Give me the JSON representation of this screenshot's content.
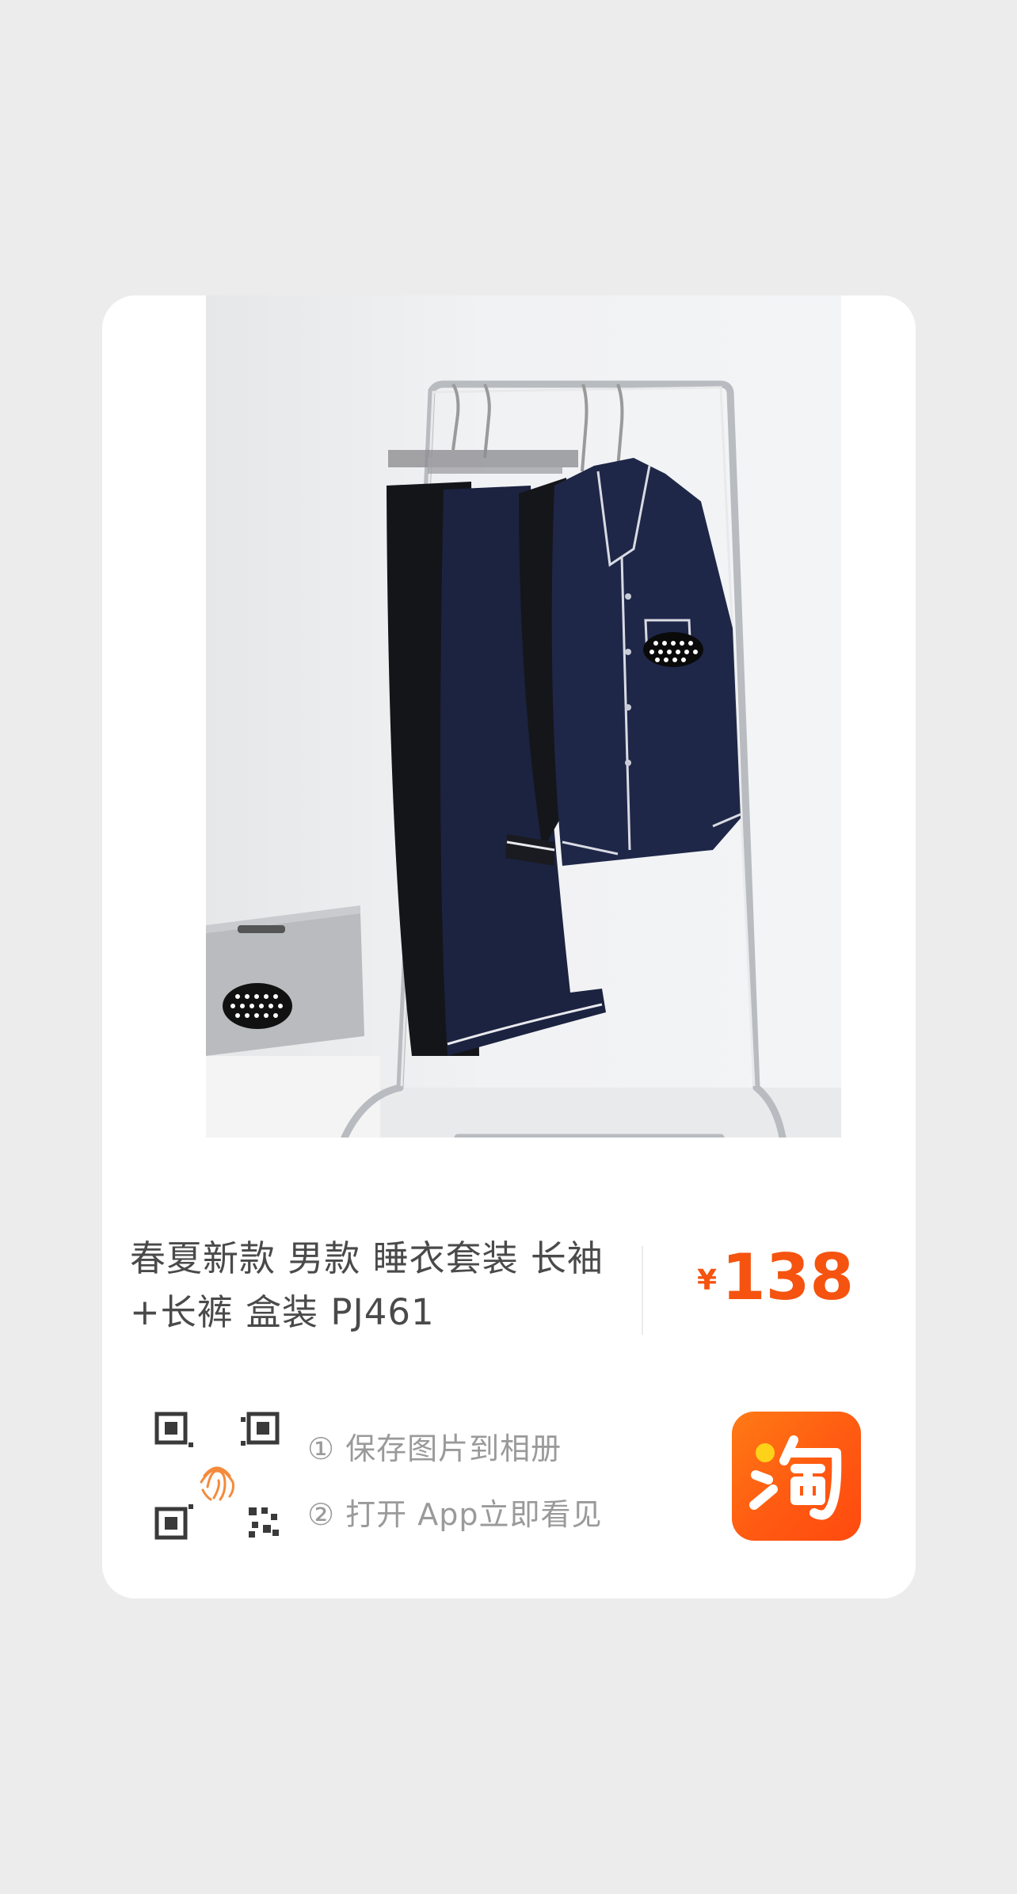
{
  "product": {
    "title": "春夏新款 男款 睡衣套装 长袖+长裤 盒装 PJ461",
    "price_currency": "¥",
    "price_amount": "138"
  },
  "steps": {
    "step1": "① 保存图片到相册",
    "step2": "② 打开 App立即看见"
  },
  "icons": {
    "qr": "qr-code-fingerprint-icon",
    "app": "taobao-logo-icon"
  },
  "colors": {
    "background": "#ececed",
    "card": "#ffffff",
    "price": "#f5530f",
    "taobao_orange": "#ff5a12",
    "title_text": "#4a4a4a",
    "step_text": "#9a9a9a"
  }
}
